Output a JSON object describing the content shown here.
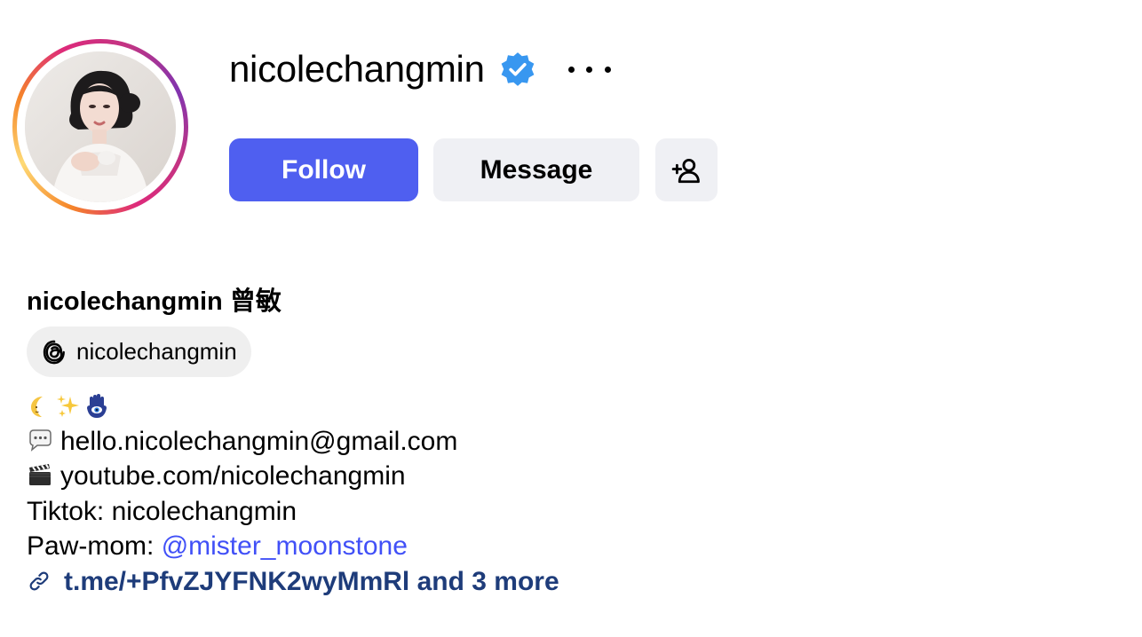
{
  "profile": {
    "username": "nicolechangmin",
    "verified_icon": "verified-badge-icon",
    "more_icon": "more-options-icon"
  },
  "buttons": {
    "follow": "Follow",
    "message": "Message",
    "add_user_icon": "add-user-icon"
  },
  "bio": {
    "full_name": "nicolechangmin 曾敏",
    "threads_handle": "nicolechangmin",
    "emoji_line": [
      "crescent-moon-emoji",
      "sparkles-emoji",
      "hamsa-emoji"
    ],
    "email": "hello.nicolechangmin@gmail.com",
    "youtube": "youtube.com/nicolechangmin",
    "tiktok": "Tiktok: nicolechangmin",
    "paw_mom_label": "Paw-mom: ",
    "paw_mom_mention": "@mister_moonstone",
    "link_text": "t.me/+PfvZJYFNK2wyMmRl and 3 more"
  },
  "colors": {
    "follow_bg": "#4f5ff0",
    "secondary_bg": "#eff0f4",
    "mention": "#4150f7",
    "link": "#1e3c7a",
    "verified": "#3897f0"
  }
}
